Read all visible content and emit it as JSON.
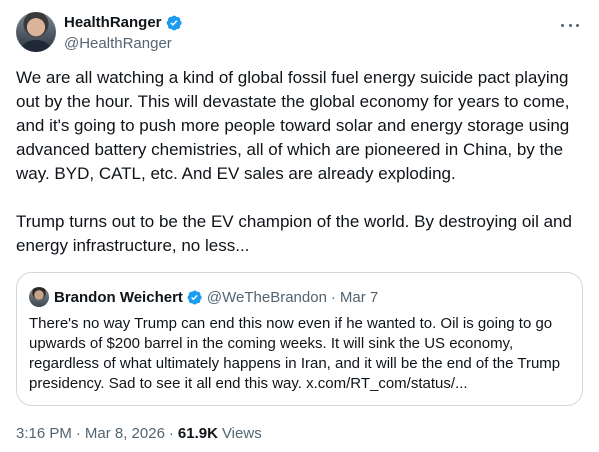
{
  "author": {
    "display_name": "HealthRanger",
    "handle": "@HealthRanger",
    "verified": true
  },
  "tweet": {
    "paragraphs": [
      "We are all watching a kind of global fossil fuel energy suicide pact playing out by the hour. This will devastate the global economy for years to come, and it's going to push more people toward solar and energy storage using advanced battery chemistries, all of which are pioneered in China, by the way. BYD, CATL, etc. And EV sales are already exploding.",
      "Trump turns out to be the EV champion of the world. By destroying oil and energy infrastructure, no less..."
    ]
  },
  "quote": {
    "display_name": "Brandon Weichert",
    "handle": "@WeTheBrandon",
    "separator": "·",
    "date": "Mar 7",
    "text": "There's no way Trump can end this now even if he wanted to. Oil is going to go upwards of $200 barrel in the coming weeks. It will sink the US economy, regardless of what ultimately happens in Iran, and it will be the end of the Trump presidency. Sad to see it all end this way. x.com/RT_com/status/..."
  },
  "meta": {
    "time": "3:16 PM",
    "separator1": "·",
    "date": "Mar 8, 2026",
    "separator2": "·",
    "views_count": "61.9K",
    "views_label": "Views"
  },
  "icons": {
    "verified": "verified-badge-icon",
    "more": "more-options-icon"
  },
  "colors": {
    "verified": "#1d9bf0",
    "secondary_text": "#536471",
    "primary_text": "#0f1419",
    "border": "#cfd9de"
  }
}
